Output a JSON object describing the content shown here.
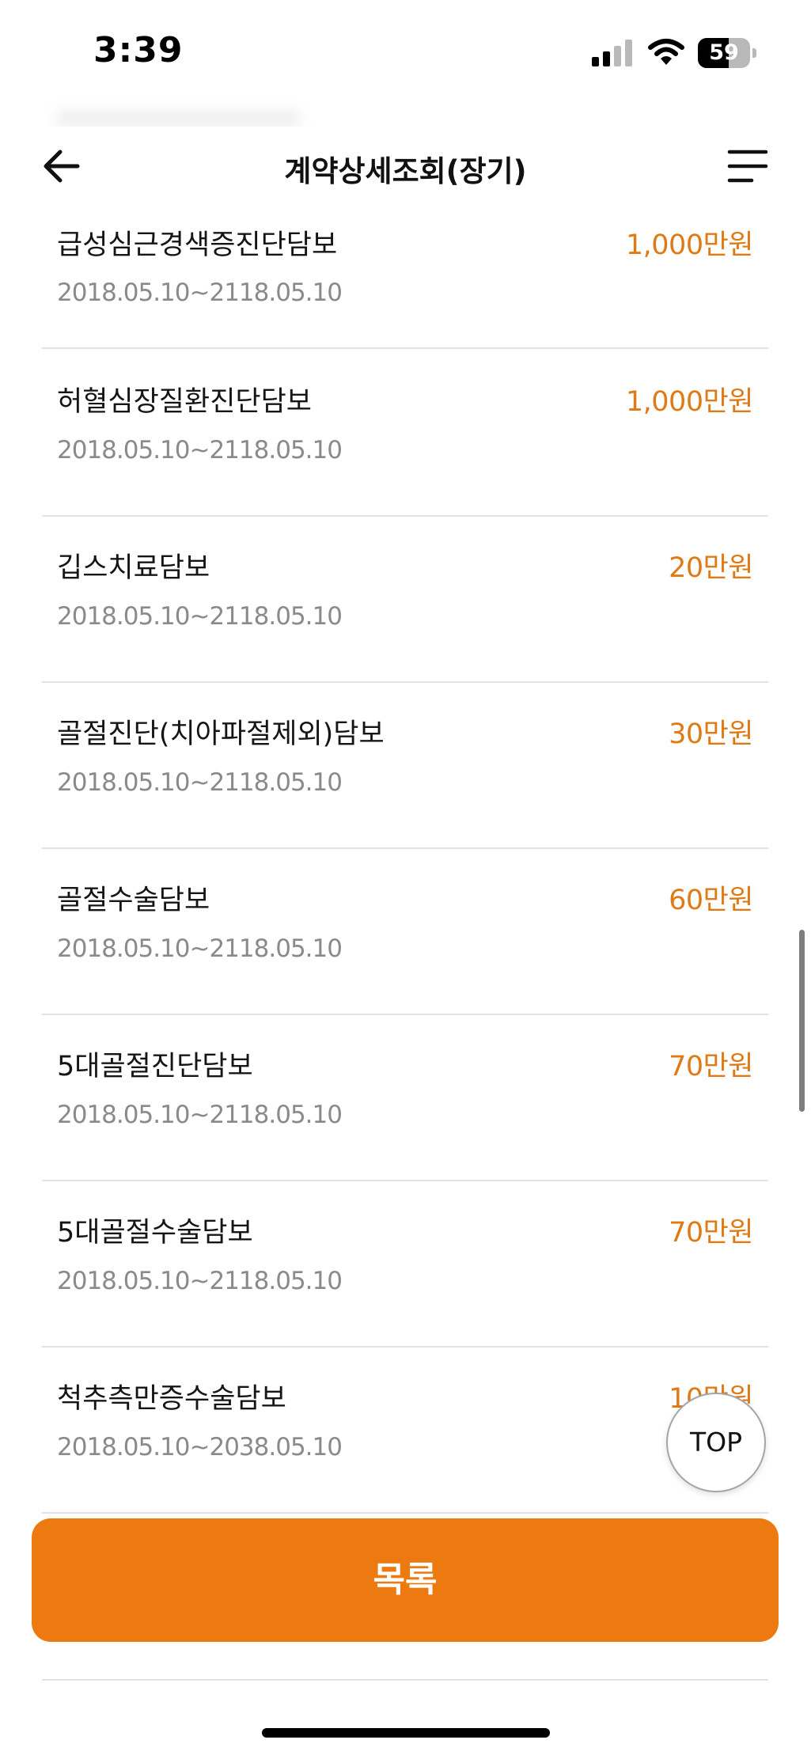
{
  "status_bar": {
    "time": "3:39",
    "battery_level": "59",
    "battery_percent": 59
  },
  "header": {
    "title": "계약상세조회(장기)",
    "back_icon": "arrow-left-icon",
    "menu_icon": "hamburger-menu-icon"
  },
  "coverages": [
    {
      "name": "급성심근경색증진단담보",
      "amount": "1,000만원",
      "period": "2018.05.10~2118.05.10"
    },
    {
      "name": "허혈심장질환진단담보",
      "amount": "1,000만원",
      "period": "2018.05.10~2118.05.10"
    },
    {
      "name": "깁스치료담보",
      "amount": "20만원",
      "period": "2018.05.10~2118.05.10"
    },
    {
      "name": "골절진단(치아파절제외)담보",
      "amount": "30만원",
      "period": "2018.05.10~2118.05.10"
    },
    {
      "name": "골절수술담보",
      "amount": "60만원",
      "period": "2018.05.10~2118.05.10"
    },
    {
      "name": "5대골절진단담보",
      "amount": "70만원",
      "period": "2018.05.10~2118.05.10"
    },
    {
      "name": "5대골절수술담보",
      "amount": "70만원",
      "period": "2018.05.10~2118.05.10"
    },
    {
      "name": "척추측만증수술담보",
      "amount": "10만원",
      "period": "2018.05.10~2038.05.10"
    }
  ],
  "top_button": {
    "label": "TOP"
  },
  "list_button": {
    "label": "목록"
  },
  "colors": {
    "accent": "#ec7a11",
    "amount": "#e07a14",
    "period": "#8a8a8a",
    "divider": "#e2e2e2"
  }
}
